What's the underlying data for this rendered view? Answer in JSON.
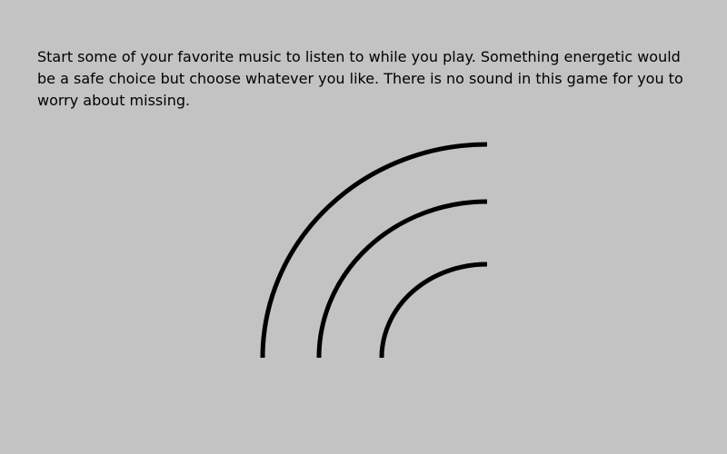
{
  "colors": {
    "background": "#c3c3c3",
    "text": "#000000",
    "arc": "#000000"
  },
  "instructions": {
    "text": "Start some of your favorite music to listen to while you play. Something energetic would be a safe choice but choose whatever you like. There is no sound in this game for you to worry about missing."
  },
  "icon": {
    "name": "music-waves-icon"
  }
}
